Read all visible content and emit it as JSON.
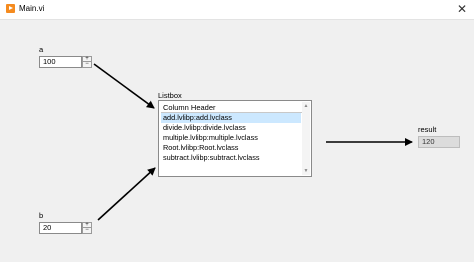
{
  "window": {
    "title": "Main.vi",
    "close_symbol": "✕"
  },
  "controls": {
    "a": {
      "label": "a",
      "value": "100"
    },
    "b": {
      "label": "b",
      "value": "20"
    },
    "increment_symbol": "+",
    "decrement_symbol": "−"
  },
  "listbox": {
    "label": "Listbox",
    "column_header": "Column Header",
    "items": [
      "add.lvlibp:add.lvclass",
      "divide.lvlibp:divide.lvclass",
      "multiple.lvlibp:multiple.lvclass",
      "Root.lvlibp:Root.lvclass",
      "subtract.lvlibp:subtract.lvclass"
    ],
    "selected_index": 0
  },
  "result": {
    "label": "result",
    "value": "120"
  },
  "colors": {
    "selection": "#cce8ff",
    "app_icon": "#f58b1f",
    "wire": "#000000"
  }
}
